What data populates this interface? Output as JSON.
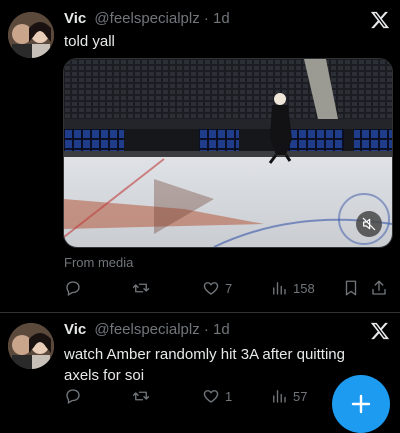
{
  "tweets": [
    {
      "author_name": "Vic",
      "handle": "@feelspecialplz",
      "separator": "·",
      "time": "1d",
      "text": "told yall",
      "media_caption": "From media",
      "replies": "",
      "retweets": "",
      "likes": "7",
      "views": "158"
    },
    {
      "author_name": "Vic",
      "handle": "@feelspecialplz",
      "separator": "·",
      "time": "1d",
      "text": "watch Amber randomly hit 3A after quitting axels for soi",
      "replies": "",
      "retweets": "",
      "likes": "1",
      "views": "57"
    }
  ],
  "colors": {
    "background": "#000000",
    "text": "#e7e9ea",
    "muted": "#71767b",
    "accent": "#1d9bf0",
    "divider": "#2f3336"
  },
  "icons": {
    "platform": "x-logo-icon",
    "reply": "reply-icon",
    "retweet": "retweet-icon",
    "like": "heart-icon",
    "views": "views-bar-icon",
    "bookmark": "bookmark-icon",
    "share": "share-icon",
    "mute": "muted-speaker-icon",
    "compose": "plus-icon"
  }
}
